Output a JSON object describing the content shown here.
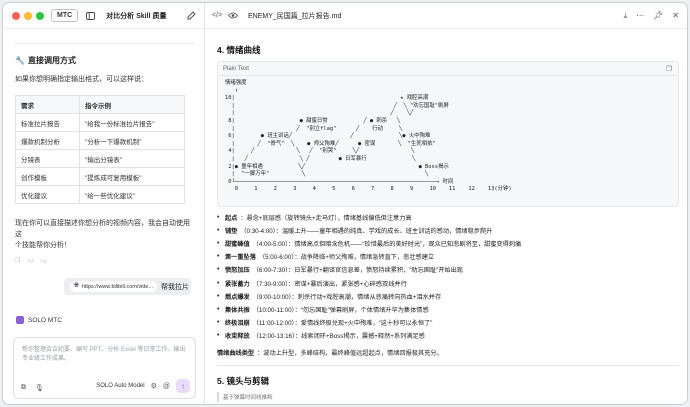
{
  "app": {
    "pill": "MTC",
    "left_title": "对比分析 Skill 质量",
    "file_title": "ENEMY_民国篇_拉片报告.md"
  },
  "colors": {
    "red": "#fe5f57",
    "yellow": "#febc2e",
    "green": "#28c840",
    "accent": "#8a5fd8"
  },
  "left": {
    "section_title": "直接调用方式",
    "intro": "如果你想明确指定输出格式，可以这样说：",
    "table": {
      "headers": [
        "需求",
        "指令示例"
      ],
      "rows": [
        [
          "标准拉片报告",
          "\"给我一份标准拉片报告\""
        ],
        [
          "爆款机制分析",
          "\"分析一下爆款机制\""
        ],
        [
          "分镜表",
          "\"输出分镜表\""
        ],
        [
          "创作模板",
          "\"提炼成可复用模板\""
        ],
        [
          "优化建议",
          "\"给一些优化建议\""
        ]
      ]
    },
    "closing_line1": "现在你可以直接描述你想分析的视频内容，我会自动使用这",
    "closing_line2": "个技能帮你分析！",
    "user_msg": {
      "link": "https://www.bilibili.com/vide...",
      "text": "帮我拉片"
    },
    "agent_label": "SOLO MTC",
    "input_placeholder_line1": "帮你整理会议纪要、编写 PPT、分析 Excel 等日常工作。输出",
    "input_placeholder_line2": "专业级工作成果。",
    "model_label": "SOLO Auto Model"
  },
  "doc": {
    "section4_title": "4. 情绪曲线",
    "code_lang": "Plain Text",
    "ascii_chart": "情绪强度\n   ↑\n10|                                                   ★ 戏腔高潮\n  |                                                 ╱  ╲ \"劝忘国耻\"刷屏\n  |                                                ╱    ╲╱\n 8|                    ● 甜蜜日常           ╱ ● 刺杀   ╲\n  |                   ╱  \"别立flag\"      ╱    行动     ╲\n 6|        ● 班主训话╱                  ╱              ╲● 火中殉难\n  |       ╱  \"脊气\"  ╲    ● 师父殉难╱      ● 密谋       ╲  \"生死相依\"\n 4|     ╱             ╲   ╱  \"别哭\"     ╲╱                ╲\n  |   ╱                ╲ ╱         ● 日军暴行              ╲\n 2|● 童年相遇           ╲╱                                   ● Boss揭示\n  |  \"一脚万年\"          ╲                                     ╲\n 0└──────────────────────────────────────────────────────────────→ 时间\n   0     1     2     3     4     5     6     7     8     9     10    11    12    13(分钟)",
    "bullets": [
      {
        "k": "起点",
        "v": "：悬念+底层感（旋转镜头+走马灯），情绪基线偏低但注意力高"
      },
      {
        "k": "铺垫",
        "v": "（0:30-4:00）：温暖上升——童年相遇的纯真、学戏的成长、班主训话的感动，情绪稳步爬升"
      },
      {
        "k": "甜蜜峰值",
        "v": "（4:00-5:00）：情绪高点但暗含危机——“珍惜最后的美好时光”，观众已知悲剧将至，甜蜜变得刺痛"
      },
      {
        "k": "第一重坠落",
        "v": "（5:00-6:00）：战争降临+师父殉难，情绪急转直下，悲壮感建立"
      },
      {
        "k": "愤怒加压",
        "v": "（6:00-7:30）：日军暴行+翻译官信息差，愤怒持续累积，“劝忘国耻”开始出现"
      },
      {
        "k": "紧张蓄力",
        "v": "（7:30-9:00）：密谋+暴后演出，紧张感+心碎感双线并行"
      },
      {
        "k": "燃点爆发",
        "v": "（9:00-10:00）：刺杀行动+戏腔高潮，情绪从悲痛转向热血+泪水并存"
      },
      {
        "k": "集体共振",
        "v": "（10:00-11:00）：“勿忘国耻”弹幕刷屏，个体情绪升华为集体情感"
      },
      {
        "k": "终极泪崩",
        "v": "（11:00-12:00）：爱情线终极兑现+火中殉难，“这十秒可以永恒了”"
      },
      {
        "k": "收束释放",
        "v": "（12:00-13:16）：线索闭环+Boss揭示，震撼+释然+系列满足感"
      }
    ],
    "curve_type_label": "情绪曲线类型",
    "curve_type_text": "：波动上升型，多峰结构，最终峰值远超起点，情绪回报极其充分。",
    "section5_title": "5. 镜头与剪辑",
    "section5_sub": "基于弹幕时间线推断"
  }
}
